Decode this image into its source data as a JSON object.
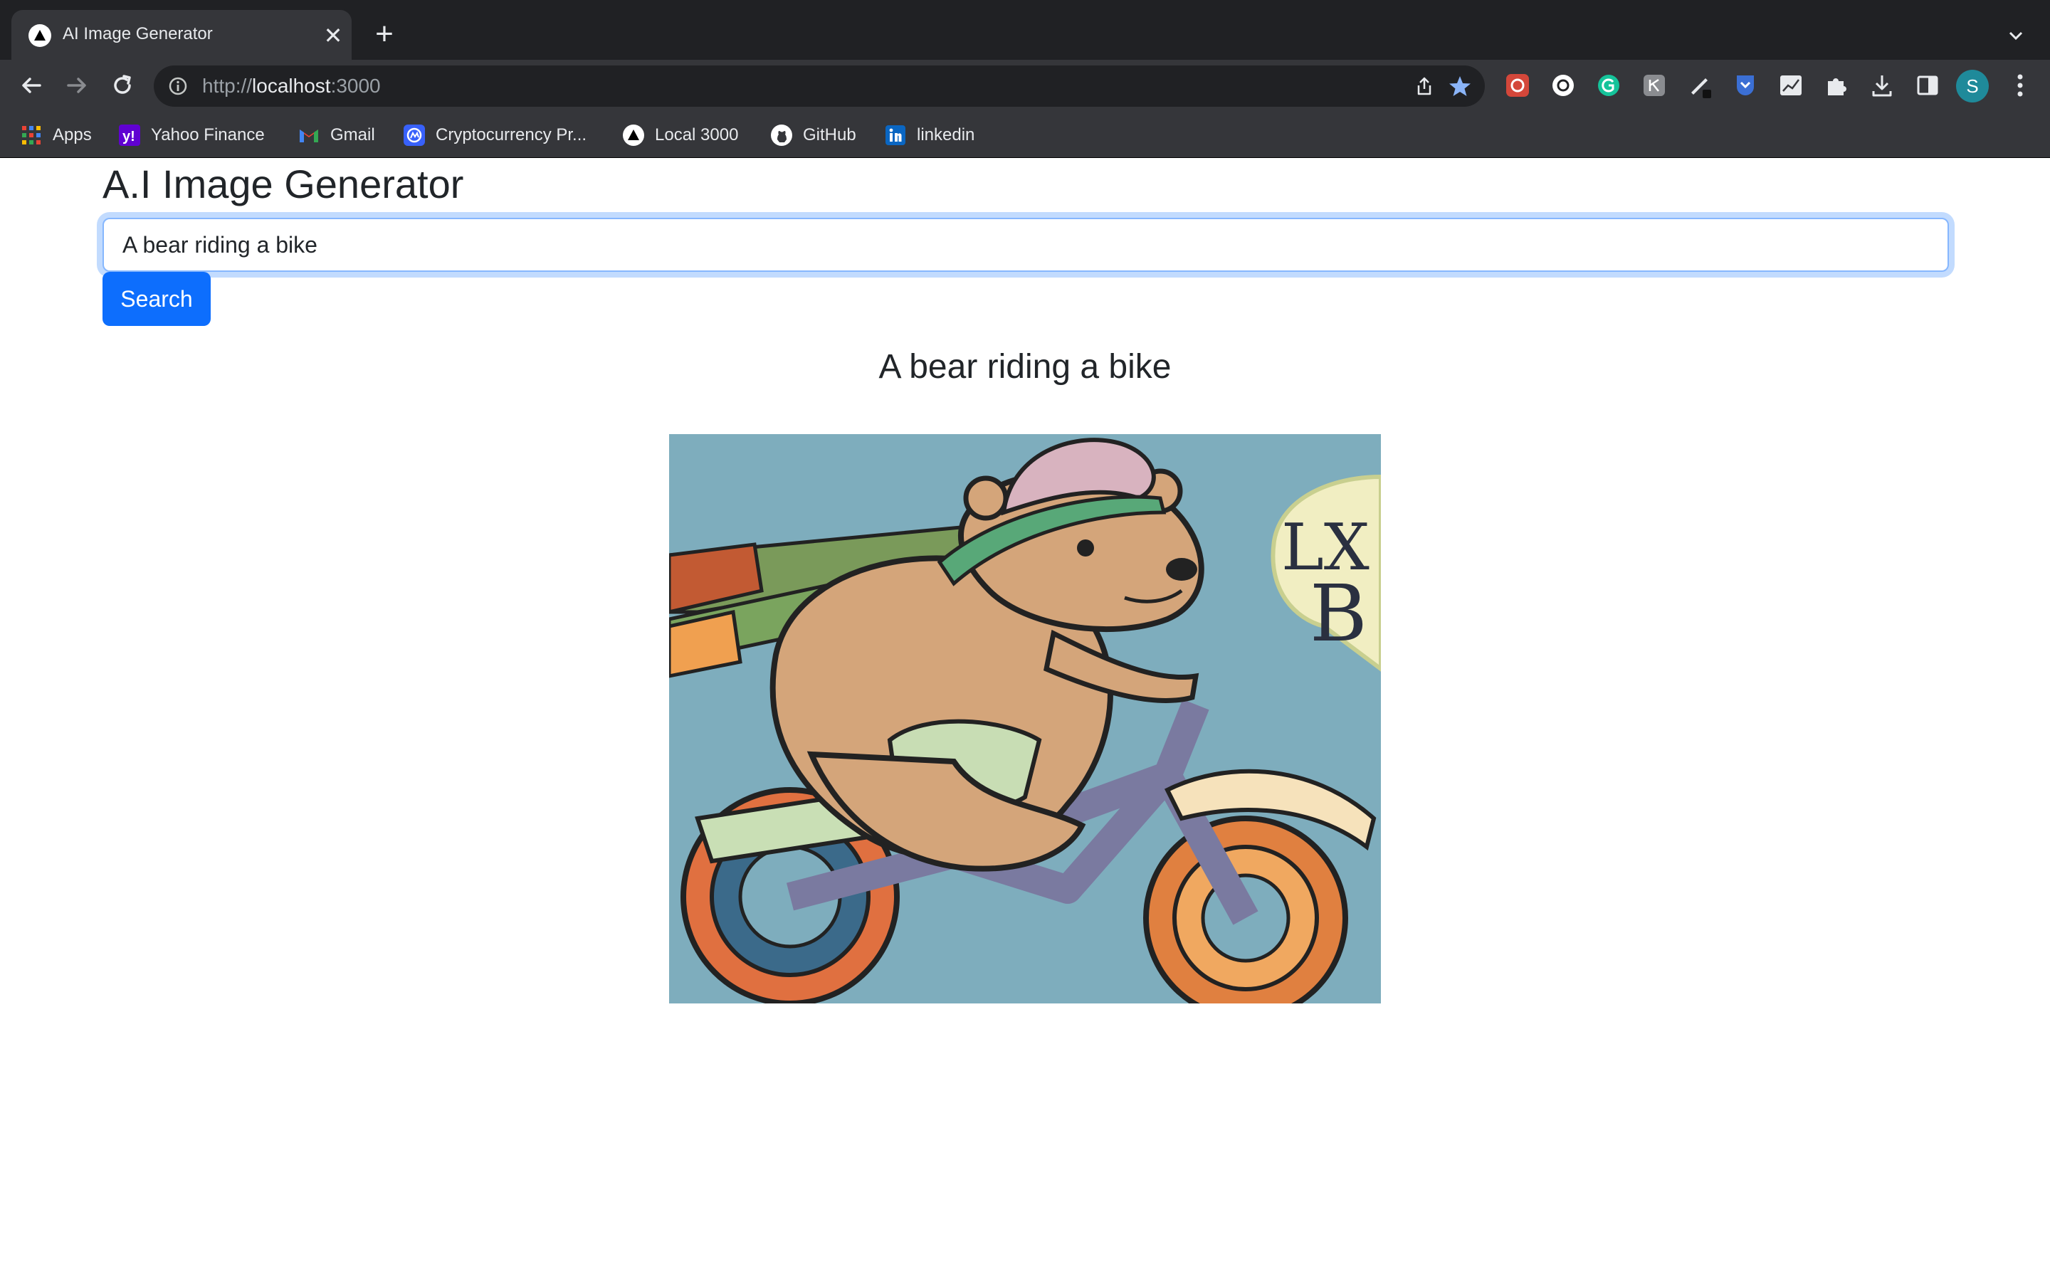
{
  "browser": {
    "tab": {
      "title": "AI Image Generator",
      "close": "✕"
    },
    "new_tab": "+",
    "url": {
      "scheme": "http://",
      "host": "localhost",
      "port": ":3000"
    },
    "profile_initial": "S",
    "bookmarks": [
      {
        "label": "Apps",
        "icon": "apps-grid-icon"
      },
      {
        "label": "Yahoo Finance",
        "icon": "yahoo-icon"
      },
      {
        "label": "Gmail",
        "icon": "gmail-icon"
      },
      {
        "label": "Cryptocurrency Pr...",
        "icon": "coinmarketcap-icon"
      },
      {
        "label": "Local 3000",
        "icon": "triangle-icon"
      },
      {
        "label": "GitHub",
        "icon": "github-icon"
      },
      {
        "label": "linkedin",
        "icon": "linkedin-icon"
      }
    ]
  },
  "page": {
    "title": "A.I Image Generator",
    "prompt_value": "A bear riding a bike",
    "search_label": "Search",
    "result_caption": "A bear riding a bike",
    "image_text": {
      "line1": "LX",
      "line2": "B"
    }
  },
  "colors": {
    "chrome_dark": "#202124",
    "chrome_mid": "#35363a",
    "primary": "#0d6efd",
    "image_bg": "#7eadbd"
  }
}
